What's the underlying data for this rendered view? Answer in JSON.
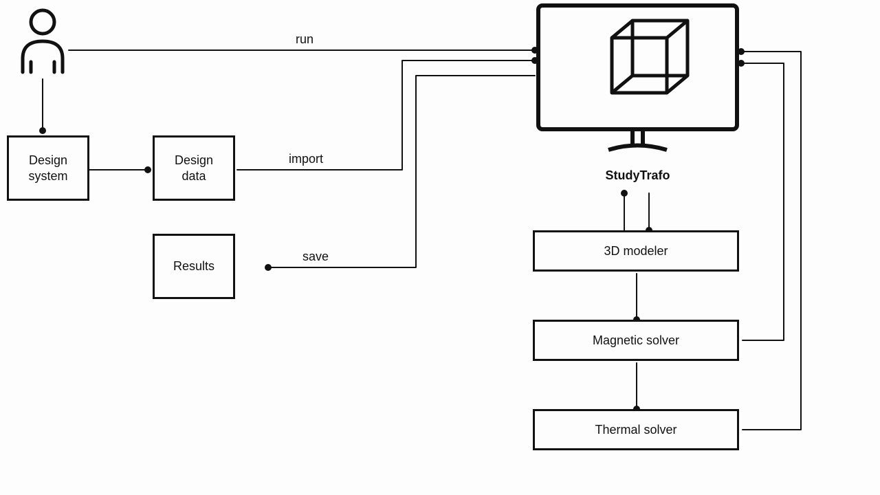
{
  "nodes": {
    "design_system": "Design\nsystem",
    "design_data": "Design\ndata",
    "results": "Results",
    "modeler": "3D modeler",
    "magnetic": "Magnetic solver",
    "thermal": "Thermal solver"
  },
  "edges": {
    "run": "run",
    "import": "import",
    "save": "save"
  },
  "study_trafo_title": "StudyTrafo"
}
